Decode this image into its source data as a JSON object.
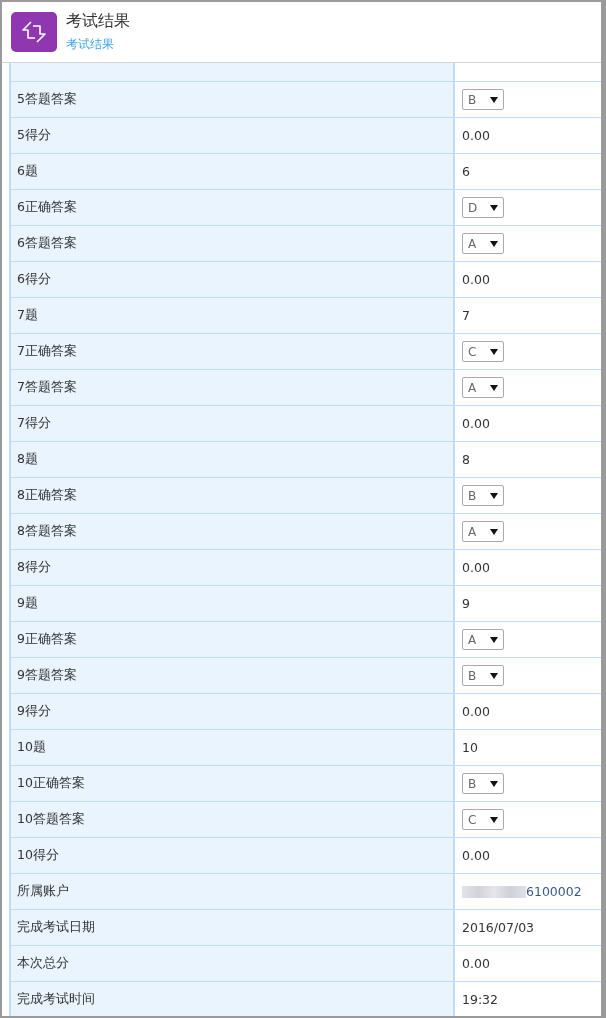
{
  "header": {
    "title": "考试结果",
    "subtitle": "考试结果"
  },
  "rows": [
    {
      "label": "5答题答案",
      "kind": "select",
      "value": "B"
    },
    {
      "label": "5得分",
      "kind": "text",
      "value": "0.00"
    },
    {
      "label": "6题",
      "kind": "text",
      "value": "6"
    },
    {
      "label": "6正确答案",
      "kind": "select",
      "value": "D"
    },
    {
      "label": "6答题答案",
      "kind": "select",
      "value": "A"
    },
    {
      "label": "6得分",
      "kind": "text",
      "value": "0.00"
    },
    {
      "label": "7题",
      "kind": "text",
      "value": "7"
    },
    {
      "label": "7正确答案",
      "kind": "select",
      "value": "C"
    },
    {
      "label": "7答题答案",
      "kind": "select",
      "value": "A"
    },
    {
      "label": "7得分",
      "kind": "text",
      "value": "0.00"
    },
    {
      "label": "8题",
      "kind": "text",
      "value": "8"
    },
    {
      "label": "8正确答案",
      "kind": "select",
      "value": "B"
    },
    {
      "label": "8答题答案",
      "kind": "select",
      "value": "A"
    },
    {
      "label": "8得分",
      "kind": "text",
      "value": "0.00"
    },
    {
      "label": "9题",
      "kind": "text",
      "value": "9"
    },
    {
      "label": "9正确答案",
      "kind": "select",
      "value": "A"
    },
    {
      "label": "9答题答案",
      "kind": "select",
      "value": "B"
    },
    {
      "label": "9得分",
      "kind": "text",
      "value": "0.00"
    },
    {
      "label": "10题",
      "kind": "text",
      "value": "10"
    },
    {
      "label": "10正确答案",
      "kind": "select",
      "value": "B"
    },
    {
      "label": "10答题答案",
      "kind": "select",
      "value": "C"
    },
    {
      "label": "10得分",
      "kind": "text",
      "value": "0.00"
    },
    {
      "label": "所属账户",
      "kind": "redacted",
      "value": "6100002"
    },
    {
      "label": "完成考试日期",
      "kind": "text",
      "value": "2016/07/03"
    },
    {
      "label": "本次总分",
      "kind": "text",
      "value": "0.00"
    },
    {
      "label": "完成考试时间",
      "kind": "text",
      "value": "19:32"
    }
  ]
}
